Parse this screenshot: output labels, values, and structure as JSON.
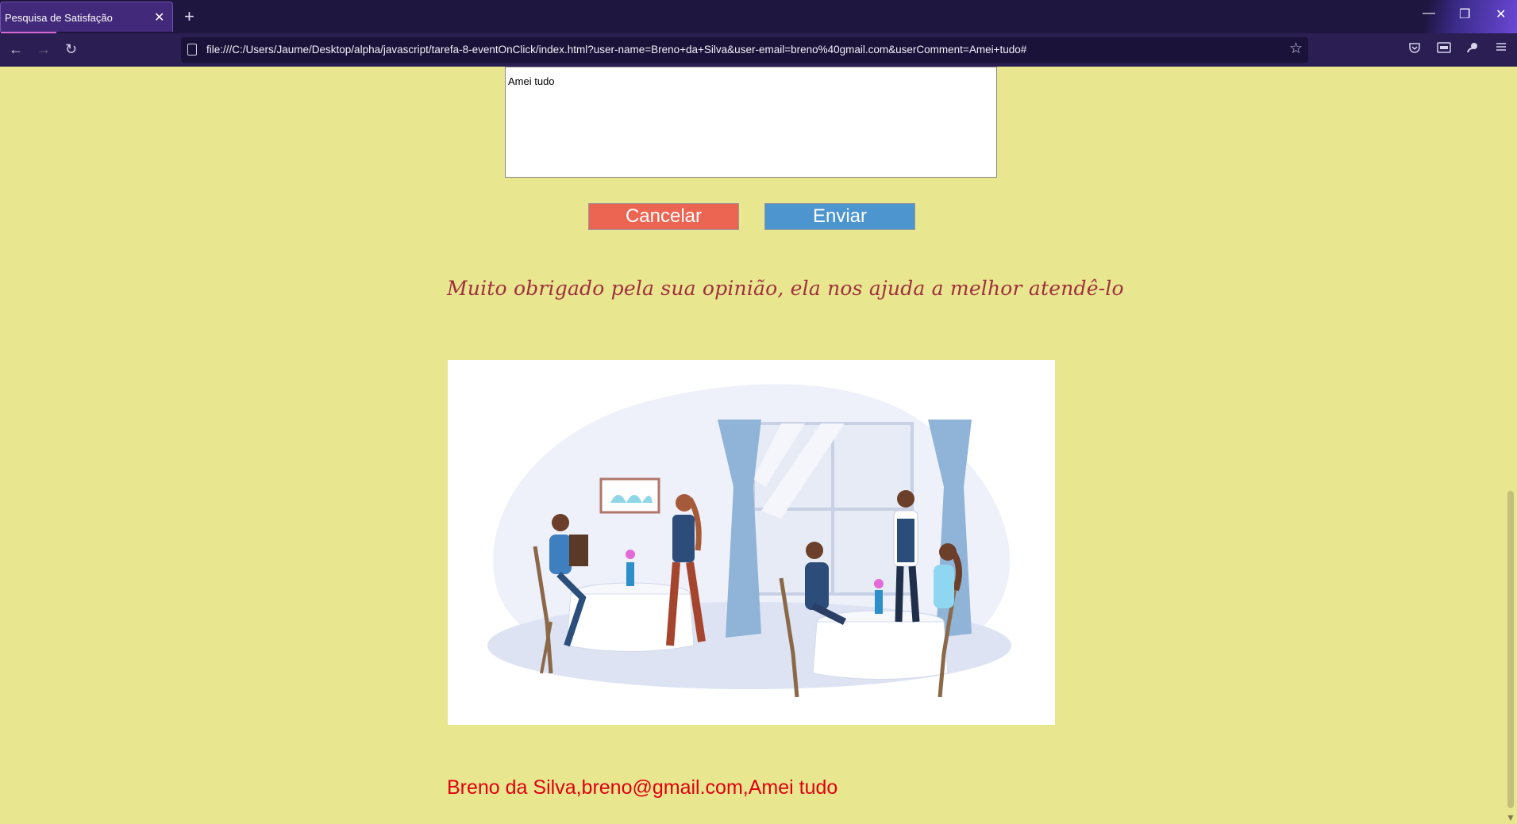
{
  "browser": {
    "tab_title": "Pesquisa de Satisfação",
    "tab_close": "✕",
    "new_tab": "+",
    "url": "file:///C:/Users/Jaume/Desktop/alpha/javascript/tarefa-8-eventOnClick/index.html?user-name=Breno+da+Silva&user-email=breno%40gmail.com&userComment=Amei+tudo#",
    "back_icon": "←",
    "forward_icon": "→",
    "reload_icon": "↻",
    "star_icon": "☆",
    "minimize": "—",
    "restore": "❐",
    "close": "✕"
  },
  "form": {
    "comment_value": "Amei tudo",
    "cancel_label": "Cancelar",
    "send_label": "Enviar"
  },
  "thanks_message": "Muito obrigado pela sua opinião, ela nos ajuda a melhor atendê-lo",
  "result_text": "Breno da Silva,breno@gmail.com,Amei tudo",
  "colors": {
    "page_bg": "#e8e68f",
    "cancel_bg": "#ec6452",
    "send_bg": "#4c95cf",
    "thanks_color": "#a0303e",
    "result_color": "#e0000f"
  }
}
